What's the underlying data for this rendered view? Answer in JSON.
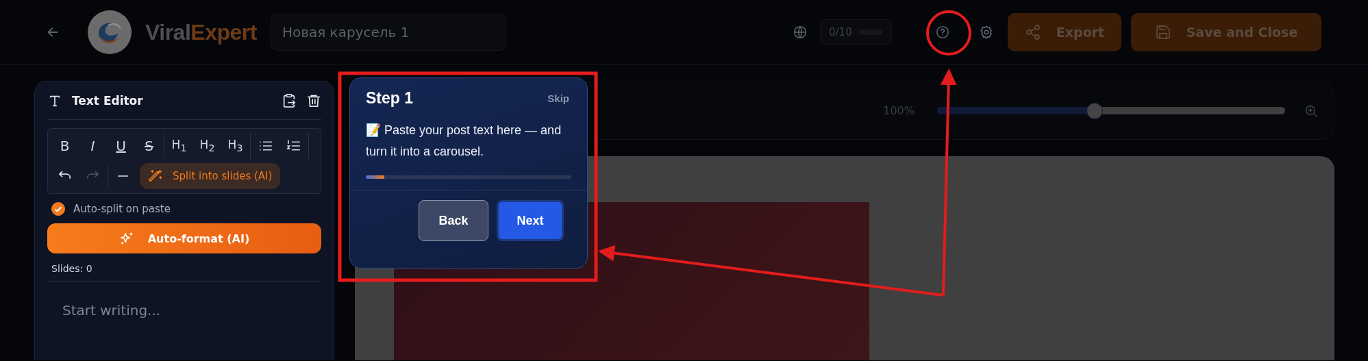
{
  "header": {
    "brand": {
      "first": "Viral",
      "second": "Expert"
    },
    "title_field": {
      "value": "Новая карусель 1"
    },
    "counter": {
      "text": "0/10",
      "level": 0
    },
    "buttons": [
      {
        "kind": "export",
        "label": "Export"
      },
      {
        "kind": "save",
        "label": "Save and Close"
      }
    ]
  },
  "editor": {
    "title": "Text Editor",
    "toolbar": [
      {
        "kind": "bold",
        "text": "B"
      },
      {
        "kind": "italic",
        "text": "I"
      },
      {
        "kind": "underline",
        "text": "U"
      },
      {
        "kind": "strike",
        "text": "S"
      },
      {
        "kind": "divider"
      },
      {
        "kind": "heading",
        "text": "H$_{1}$"
      },
      {
        "kind": "heading",
        "text": "H$_{2}$"
      },
      {
        "kind": "heading",
        "text": "H$_{3}$"
      },
      {
        "kind": "divider"
      },
      {
        "kind": "bullets"
      },
      {
        "kind": "numbers"
      },
      {
        "kind": "divider"
      },
      {
        "kind": "undo",
        "disabled": false
      },
      {
        "kind": "redo",
        "disabled": true
      },
      {
        "kind": "divider"
      },
      {
        "kind": "rule"
      },
      {
        "kind": "split",
        "text": "Split into slides (AI)"
      }
    ],
    "auto_split": {
      "label": "Auto-split on paste",
      "checked": true
    },
    "auto_format": {
      "label": "Auto-format (AI)"
    },
    "slides_count": "Slides: 0",
    "placeholder": "Start writing..."
  },
  "zoom": {
    "reading": "100%",
    "level": 0.45
  },
  "tour": {
    "title": "Step 1",
    "skip": "Skip",
    "text": "📝 Paste your post text here — and turn it into a carousel.",
    "level": 0.09,
    "buttons": [
      {
        "kind": "back",
        "label": "Back"
      },
      {
        "kind": "next",
        "label": "Next"
      }
    ]
  }
}
